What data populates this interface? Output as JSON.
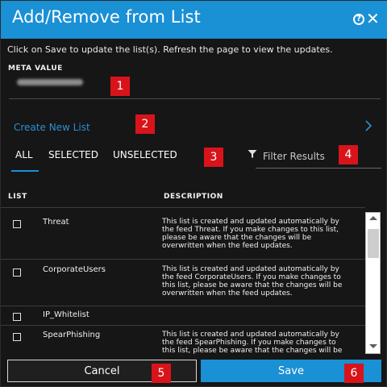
{
  "dialog": {
    "title": "Add/Remove from List",
    "instructions": "Click on Save to update the list(s). Refresh the page to view the updates.",
    "meta_label": "META VALUE",
    "create_list_label": "Create New List",
    "tabs": [
      {
        "label": "ALL",
        "active": true
      },
      {
        "label": "SELECTED",
        "active": false
      },
      {
        "label": "UNSELECTED",
        "active": false
      }
    ],
    "filter_placeholder": "Filter Results",
    "columns": {
      "list": "LIST",
      "description": "DESCRIPTION"
    },
    "rows": [
      {
        "name": "Threat",
        "checked": false,
        "desc_lines": [
          "This list is created and updated automatically by",
          "the feed Threat. If you make changes to this list,",
          "please be aware that the changes will be",
          "overwritten when the feed updates."
        ]
      },
      {
        "name": "CorporateUsers",
        "checked": false,
        "desc_lines": [
          "This list is created and updated automatically by",
          "the feed CorporateUsers. If you make changes to",
          "this list, please be aware that the changes will be",
          "overwritten when the feed updates."
        ]
      },
      {
        "name": "IP_Whitelist",
        "checked": false,
        "desc_lines": []
      },
      {
        "name": "SpearPhishing",
        "checked": false,
        "desc_lines": [
          "This list is created and updated automatically by",
          "the feed SpearPhishing. If you make changes to",
          "this list, please be aware that the changes will be"
        ]
      }
    ],
    "cancel_label": "Cancel",
    "save_label": "Save"
  },
  "annotations": [
    "1",
    "2",
    "3",
    "4",
    "5",
    "6"
  ],
  "colors": {
    "accent": "#1a90d5",
    "background": "#161617",
    "annotation_badge": "#d8141a",
    "link": "#2a8fd0"
  },
  "icons": {
    "help": "help-icon",
    "close": "close-icon",
    "chevron": "chevron-right-icon",
    "filter": "filter-icon"
  }
}
